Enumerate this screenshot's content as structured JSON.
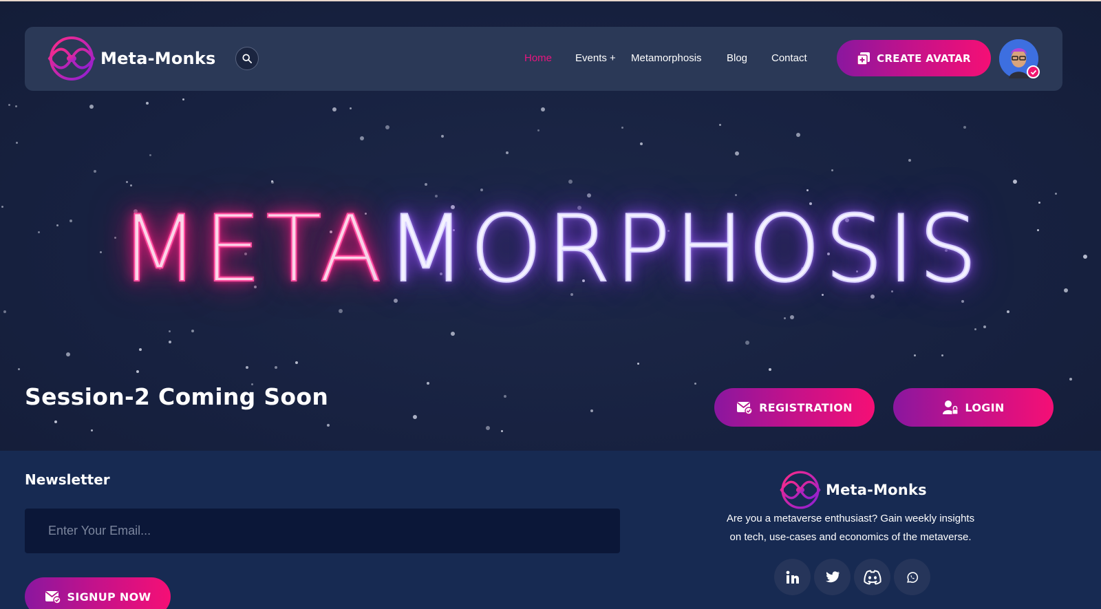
{
  "brand": {
    "name": "Meta-Monks",
    "accent": "#e8157f",
    "gradient": [
      "#8a179f",
      "#f50f75"
    ]
  },
  "header": {
    "search_icon": "search-icon",
    "nav": [
      {
        "label": "Home",
        "active": true
      },
      {
        "label": "Events +"
      },
      {
        "label": "Metamorphosis"
      },
      {
        "label": "Blog"
      },
      {
        "label": "Contact"
      }
    ],
    "create_avatar_label": "CREATE AVATAR"
  },
  "hero": {
    "title_part1": "META",
    "title_part2": "MORPHOSIS",
    "session_text": "Session-2 Coming Soon",
    "registration_label": "REGISTRATION",
    "login_label": "LOGIN"
  },
  "footer": {
    "newsletter_title": "Newsletter",
    "email_placeholder": "Enter Your Email...",
    "signup_label": "SIGNUP NOW",
    "brand_name": "Meta-Monks",
    "about_line1": "Are you a metaverse enthusiast? Gain weekly insights",
    "about_line2": "on tech, use-cases and economics of the metaverse.",
    "social": [
      "linkedin-icon",
      "twitter-icon",
      "discord-icon",
      "whatsapp-icon"
    ]
  }
}
